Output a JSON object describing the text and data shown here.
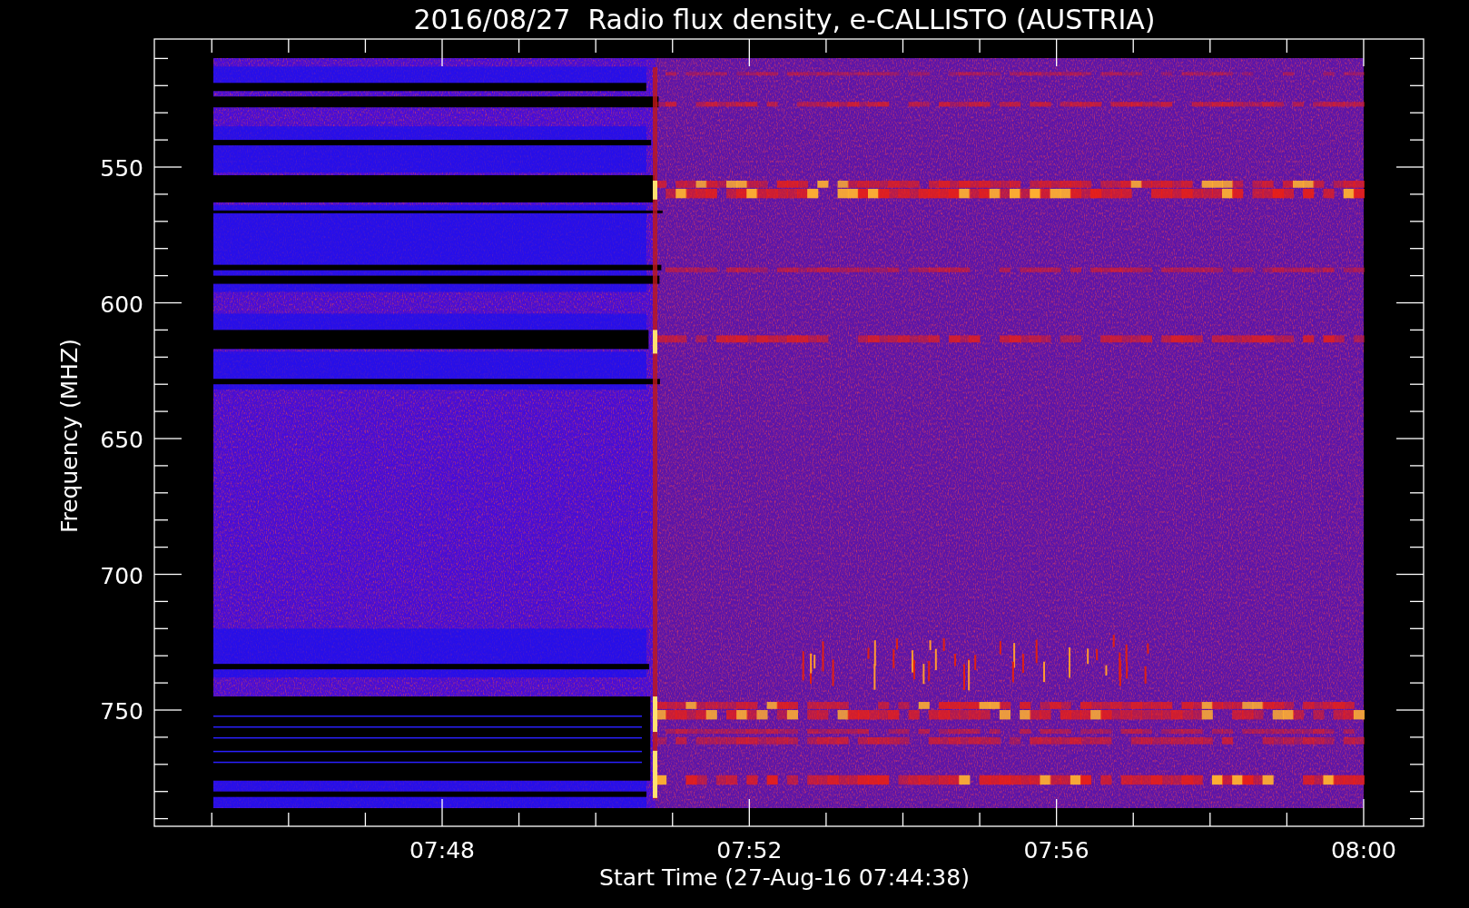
{
  "title": "2016/08/27  Radio flux density, e-CALLISTO (AUSTRIA)",
  "y_axis": {
    "label": "Frequency (MHZ)",
    "ticks": [
      "550",
      "600",
      "650",
      "700",
      "750"
    ]
  },
  "x_axis": {
    "label": "Start Time (27-Aug-16 07:44:38)",
    "ticks": [
      "07:48",
      "07:52",
      "07:56",
      "08:00"
    ]
  }
}
